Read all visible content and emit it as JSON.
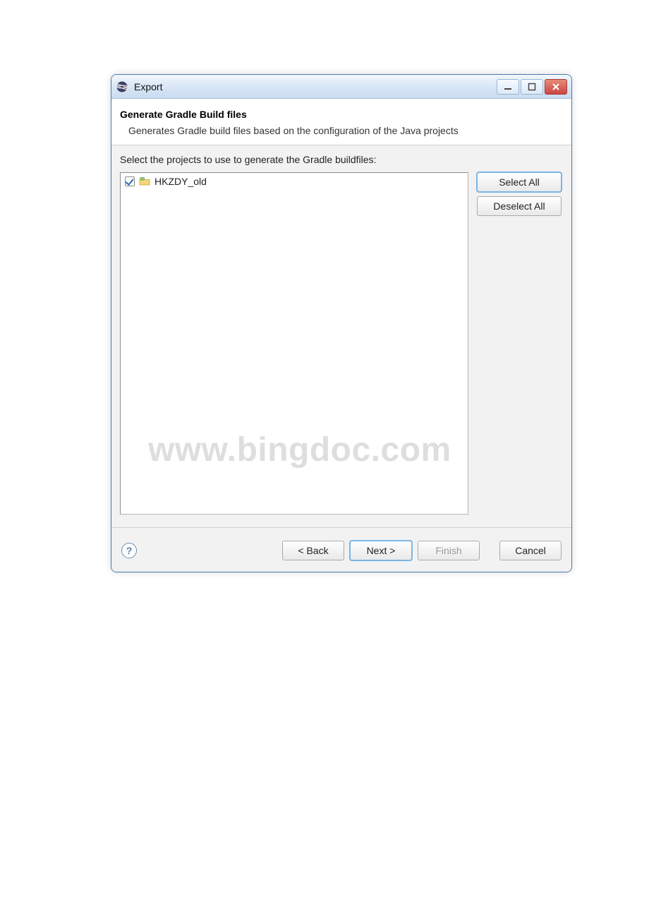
{
  "titlebar": {
    "title": "Export"
  },
  "header": {
    "title": "Generate Gradle Build files",
    "description": "Generates Gradle build files based on the configuration of the Java projects"
  },
  "content": {
    "label": "Select the projects to use to generate the Gradle buildfiles:",
    "projects": [
      {
        "name": "HKZDY_old",
        "checked": true
      }
    ]
  },
  "side_buttons": {
    "select_all": "Select All",
    "deselect_all": "Deselect All"
  },
  "footer": {
    "back": "< Back",
    "next": "Next >",
    "finish": "Finish",
    "cancel": "Cancel"
  },
  "watermark": "www.bingdoc.com"
}
